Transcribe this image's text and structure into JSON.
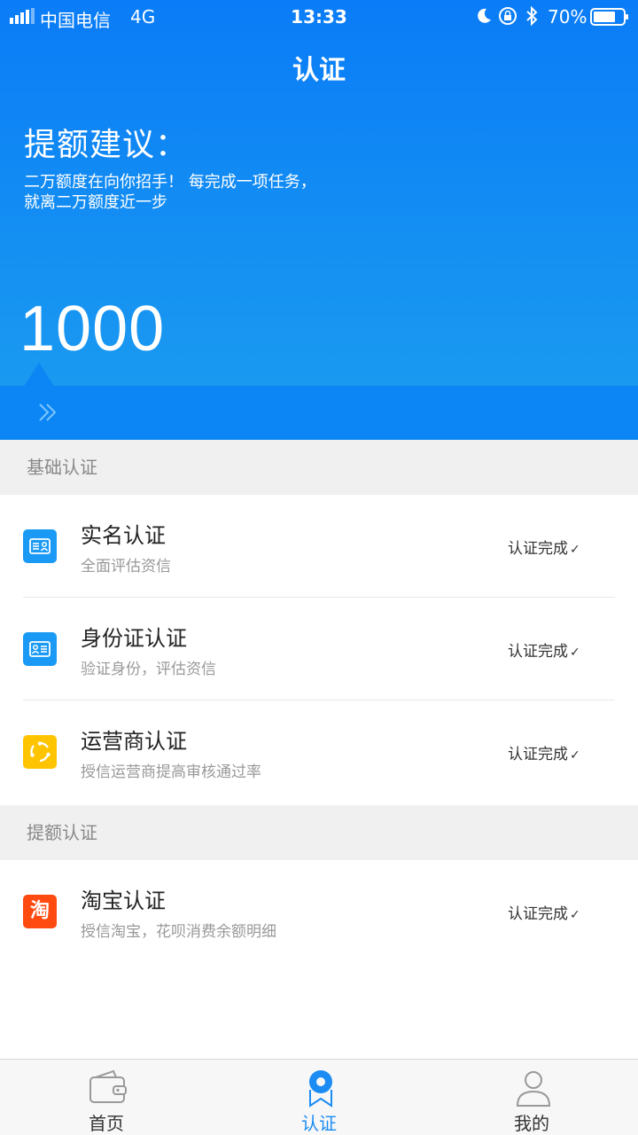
{
  "status_bar": {
    "carrier": "中国电信",
    "network": "4G",
    "time": "13:33",
    "battery_percent": "70%"
  },
  "nav": {
    "title": "认证"
  },
  "hero": {
    "advice_title": "提额建议：",
    "advice_line1": "二万额度在向你招手！ 每完成一项任务，",
    "advice_line2": "就离二万额度近一步",
    "amount": "1000"
  },
  "sections": [
    {
      "title": "基础认证",
      "items": [
        {
          "title": "实名认证",
          "subtitle": "全面评估资信",
          "status": "认证完成",
          "icon": "id-card-icon",
          "color": "#1a9af5"
        },
        {
          "title": "身份证认证",
          "subtitle": "验证身份，评估资信",
          "status": "认证完成",
          "icon": "identity-card-icon",
          "color": "#1a9af5"
        },
        {
          "title": "运营商认证",
          "subtitle": "授信运营商提高审核通过率",
          "status": "认证完成",
          "icon": "carrier-icon",
          "color": "#ffc400"
        }
      ]
    },
    {
      "title": "提额认证",
      "items": [
        {
          "title": "淘宝认证",
          "subtitle": "授信淘宝，花呗消费余额明细",
          "status": "认证完成",
          "icon": "taobao-icon",
          "icon_text": "淘",
          "color": "#ff4a10"
        }
      ]
    }
  ],
  "tabs": [
    {
      "label": "首页",
      "icon": "wallet-icon"
    },
    {
      "label": "认证",
      "icon": "location-badge-icon",
      "active": true
    },
    {
      "label": "我的",
      "icon": "person-icon"
    }
  ],
  "colors": {
    "primary": "#0a7cf7",
    "active_tab": "#1a8cf4"
  }
}
